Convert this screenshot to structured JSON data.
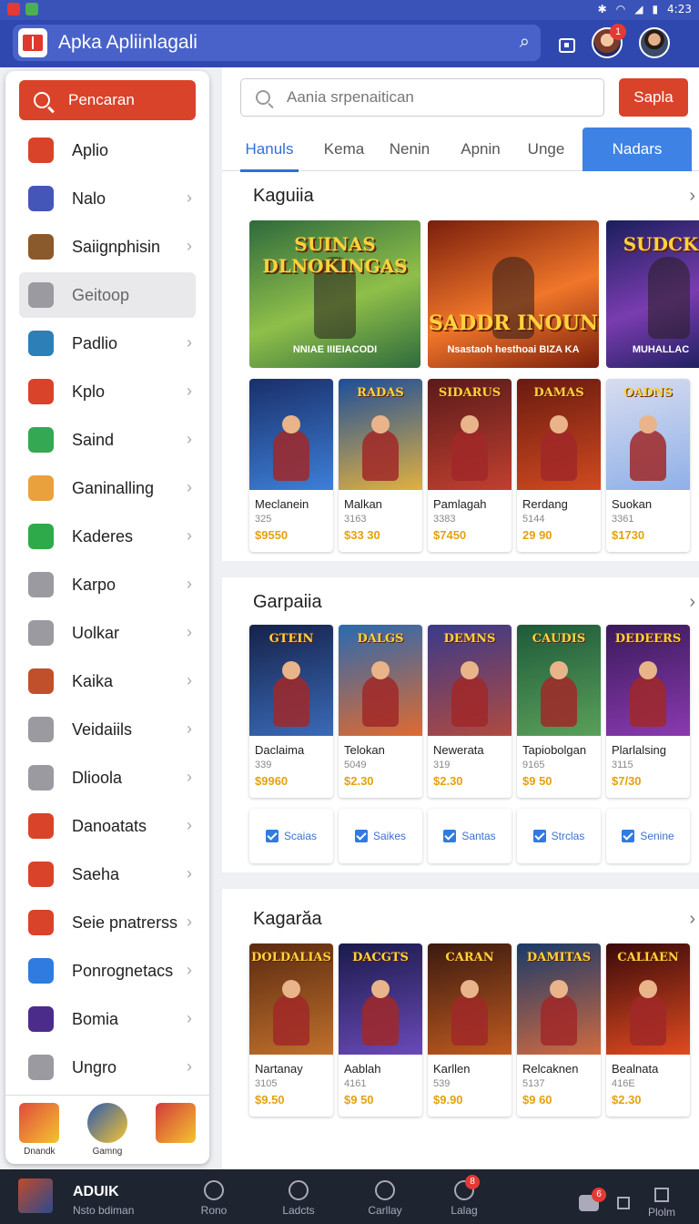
{
  "status_bar": {
    "time": "4:23",
    "battery": "▮"
  },
  "app": {
    "title": "Apka Apliinlagali",
    "notification_count": "1"
  },
  "sidebar": {
    "search_label": "Pencaran",
    "items": [
      {
        "label": "Aplio",
        "icon": "app-icon",
        "color": "#d9432a",
        "chevron": false
      },
      {
        "label": "Nalo",
        "icon": "list-icon",
        "color": "#4456b8",
        "chevron": true
      },
      {
        "label": "Saiignphisin",
        "icon": "character-icon",
        "color": "#8a5a2c",
        "chevron": true
      },
      {
        "label": "Geitoop",
        "icon": "grid-icon",
        "color": "#9a9aa0",
        "chevron": false
      },
      {
        "label": "Padlio",
        "icon": "game-icon",
        "color": "#2d7fb8",
        "chevron": true
      },
      {
        "label": "Kplo",
        "icon": "bag-icon",
        "color": "#d9432a",
        "chevron": true
      },
      {
        "label": "Saind",
        "icon": "chrome-icon",
        "color": "#34a853",
        "chevron": true
      },
      {
        "label": "Ganinalling",
        "icon": "emoji-icon",
        "color": "#e8a13c",
        "chevron": true
      },
      {
        "label": "Kaderes",
        "icon": "phone-icon",
        "color": "#2eaa4a",
        "chevron": true
      },
      {
        "label": "Karpo",
        "icon": "tag-icon",
        "color": "#9a9aa0",
        "chevron": true
      },
      {
        "label": "Uolkar",
        "icon": "frame-icon",
        "color": "#9a9aa0",
        "chevron": true
      },
      {
        "label": "Kaika",
        "icon": "hero-icon",
        "color": "#c0502c",
        "chevron": true
      },
      {
        "label": "Veidaiils",
        "icon": "flag-icon",
        "color": "#9a9aa0",
        "chevron": true
      },
      {
        "label": "Dlioola",
        "icon": "clock-icon",
        "color": "#9a9aa0",
        "chevron": true
      },
      {
        "label": "Danoatats",
        "icon": "star-icon",
        "color": "#d9432a",
        "chevron": true
      },
      {
        "label": "Saeha",
        "icon": "bookmark-icon",
        "color": "#d9432a",
        "chevron": true
      },
      {
        "label": "Seie pnatrerss",
        "icon": "badge-icon",
        "color": "#d9432a",
        "chevron": true
      },
      {
        "label": "Ponrognetacs",
        "icon": "chat-icon",
        "color": "#2f7be0",
        "chevron": true
      },
      {
        "label": "Bomia",
        "icon": "bolt-icon",
        "color": "#4b2c8a",
        "chevron": true
      },
      {
        "label": "Ungro",
        "icon": "shuffle-icon",
        "color": "#9a9aa0",
        "chevron": true
      }
    ],
    "bottom_tiles": [
      {
        "label": "Dnandk",
        "color": "#e04a3c"
      },
      {
        "label": "Gamng",
        "color": "#2d5ab0"
      },
      {
        "label": "",
        "color": "#d43a3a"
      }
    ]
  },
  "search": {
    "placeholder": "Aania srpenaitican",
    "button_label": "Sapla"
  },
  "tabs": [
    "Hanuls",
    "Kema",
    "Nenin",
    "Apnin",
    "Unge",
    "Nadars"
  ],
  "sections": [
    {
      "title": "Kaguiia",
      "banners": [
        {
          "title": "SUINAS DLNOKINGAS",
          "subtitle": "NNIAE IIIEIACODI",
          "colors": [
            "#2e6a3c",
            "#8fbf4a"
          ]
        },
        {
          "title": "SADDR INOUN",
          "subtitle": "Nsastaoh hesthoai BIZA KA",
          "colors": [
            "#7a1e0c",
            "#f0762a"
          ]
        },
        {
          "title": "SUDCK",
          "subtitle": "MUHALLAC",
          "colors": [
            "#1a1f5c",
            "#7a3cb0"
          ]
        }
      ],
      "cards": [
        {
          "name": "Meclanein",
          "meta": "325",
          "price": "$9550",
          "title": "",
          "colors": [
            "#1a2f6a",
            "#3d7fd8"
          ]
        },
        {
          "name": "Malkan",
          "meta": "3163",
          "price": "$33 30",
          "title": "RADAS",
          "colors": [
            "#1d4e9a",
            "#e0b040"
          ]
        },
        {
          "name": "Pamlagah",
          "meta": "3383",
          "price": "$7450",
          "title": "SIDARUS",
          "colors": [
            "#5a1a1a",
            "#c04030"
          ]
        },
        {
          "name": "Rerdang",
          "meta": "5144",
          "price": "29 90",
          "title": "DAMAS",
          "colors": [
            "#6a1a10",
            "#d04a20"
          ]
        },
        {
          "name": "Suokan",
          "meta": "3361",
          "price": "$1730",
          "title": "OADNS",
          "colors": [
            "#d8dcf0",
            "#8fb0e8"
          ]
        }
      ]
    },
    {
      "title": "Garpaiia",
      "cards": [
        {
          "name": "Daclaima",
          "meta": "339",
          "price": "$9960",
          "title": "GTEIN",
          "colors": [
            "#16224a",
            "#3a6ab8"
          ]
        },
        {
          "name": "Telokan",
          "meta": "5049",
          "price": "$2.30",
          "title": "DALGS",
          "colors": [
            "#2a6ab0",
            "#e06a30"
          ]
        },
        {
          "name": "Newerata",
          "meta": "319",
          "price": "$2.30",
          "title": "DEMNS",
          "colors": [
            "#3a3a8a",
            "#b04a40"
          ]
        },
        {
          "name": "Tapiobolgan",
          "meta": "9165",
          "price": "$9 50",
          "title": "CAUDIS",
          "colors": [
            "#1e5a3a",
            "#5aa05a"
          ]
        },
        {
          "name": "Plarlalsing",
          "meta": "3115",
          "price": "$7/30",
          "title": "DEDEERS",
          "colors": [
            "#3a1a5a",
            "#8a3ab0"
          ]
        }
      ],
      "filters": [
        "Scaias",
        "Saikes",
        "Santas",
        "Strclas",
        "Senine"
      ]
    },
    {
      "title": "Kagarăa",
      "cards": [
        {
          "name": "Nartanay",
          "meta": "3105",
          "price": "$9.50",
          "title": "DOLDALIAS",
          "colors": [
            "#5a2a10",
            "#c0702c"
          ]
        },
        {
          "name": "Aablah",
          "meta": "4161",
          "price": "$9 50",
          "title": "DACGTS",
          "colors": [
            "#1a1a4a",
            "#6a4ab8"
          ]
        },
        {
          "name": "Karllen",
          "meta": "539",
          "price": "$9.90",
          "title": "CARAN",
          "colors": [
            "#3a1a10",
            "#c05a20"
          ]
        },
        {
          "name": "Relcaknen",
          "meta": "5137",
          "price": "$9 60",
          "title": "DAMITAS",
          "colors": [
            "#1a3a6a",
            "#d06a40"
          ]
        },
        {
          "name": "Bealnata",
          "meta": "416E",
          "price": "$2.30",
          "title": "CALIAEN",
          "colors": [
            "#3a0a0a",
            "#e04a20"
          ]
        }
      ]
    }
  ],
  "bottom_nav": {
    "profile_name": "ADUIK",
    "profile_sub": "Nsto bdiman",
    "items": [
      {
        "label": "Rono",
        "icon": "search-icon",
        "badge": ""
      },
      {
        "label": "Ladcts",
        "icon": "person-icon",
        "badge": ""
      },
      {
        "label": "Carllay",
        "icon": "gamepad-icon",
        "badge": ""
      },
      {
        "label": "Lalag",
        "icon": "cart-icon",
        "badge": "8"
      }
    ],
    "right_label": "Plolm",
    "right_badge": "6"
  }
}
